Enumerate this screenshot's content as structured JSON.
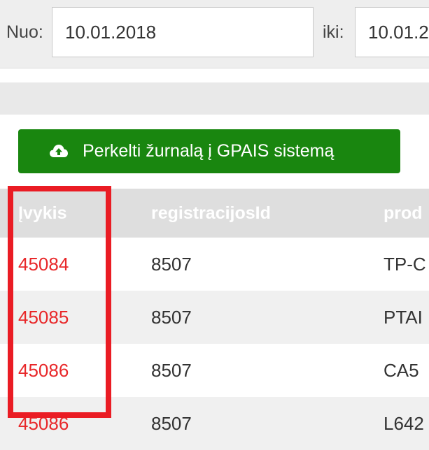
{
  "filters": {
    "from_label": "Nuo:",
    "from_value": "10.01.2018",
    "to_label": "iki:",
    "to_value": "10.01.2"
  },
  "toolbar": {
    "export_button_label": "Perkelti žurnalą į GPAIS sistemą",
    "export_button_icon": "cloud-upload-icon",
    "export_button_color": "#19860f"
  },
  "table": {
    "columns": [
      "Įvykis",
      "registracijosId",
      "prod"
    ],
    "rows": [
      [
        "45084",
        "8507",
        "TP-C"
      ],
      [
        "45085",
        "8507",
        "PTAI"
      ],
      [
        "45086",
        "8507",
        "CA5"
      ],
      [
        "45086",
        "8507",
        "L642"
      ]
    ]
  },
  "colors": {
    "link_red": "#e8282a",
    "highlight_red": "#ea1c24"
  }
}
